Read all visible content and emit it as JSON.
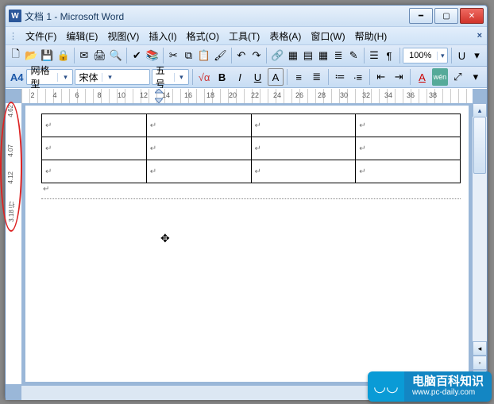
{
  "title": "文档 1 - Microsoft Word",
  "menus": {
    "file": "文件(F)",
    "edit": "编辑(E)",
    "view": "视图(V)",
    "insert": "插入(I)",
    "format": "格式(O)",
    "tools": "工具(T)",
    "table": "表格(A)",
    "window": "窗口(W)",
    "help": "帮助(H)"
  },
  "toolbar": {
    "zoom": "100%"
  },
  "format": {
    "style": "网格型",
    "font": "宋体",
    "size": "五号",
    "bold": "B",
    "italic": "I",
    "underline": "U",
    "charA": "A",
    "fontcolor": "A",
    "asian": "wén"
  },
  "ruler_h": [
    "2",
    "4",
    "6",
    "8",
    "10",
    "12",
    "14",
    "16",
    "18",
    "20",
    "22",
    "24",
    "26",
    "28",
    "30",
    "32",
    "34",
    "36",
    "38"
  ],
  "ruler_v": {
    "top": "4.62",
    "row": "4.07",
    "mv": "4.12",
    "below": "3.18 行"
  },
  "cell_marker": "↵",
  "watermark": {
    "title": "电脑百科知识",
    "url": "www.pc-daily.com"
  },
  "chart_data": {
    "type": "table",
    "columns": 4,
    "rows": 3,
    "row_height_cm": 1.12,
    "row_height_lines": 3.18,
    "cells": [
      [
        "",
        "",
        "",
        ""
      ],
      [
        "",
        "",
        "",
        ""
      ],
      [
        "",
        "",
        "",
        ""
      ]
    ]
  }
}
